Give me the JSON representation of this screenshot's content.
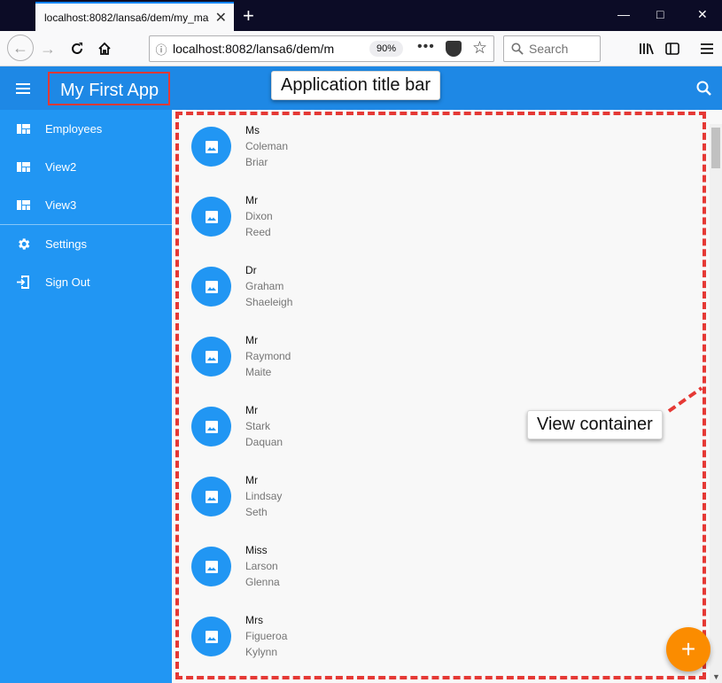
{
  "browser": {
    "tab_title": "localhost:8082/lansa6/dem/my_ma",
    "tab_close": "✕",
    "new_tab": "+",
    "url": "localhost:8082/lansa6/dem/m",
    "zoom": "90%",
    "search_placeholder": "Search",
    "more_icon": "•••",
    "star_icon": "☆"
  },
  "app": {
    "title": "My First App",
    "title_callout": "Application title bar",
    "view_callout": "View container",
    "fab_label": "+"
  },
  "sidebar": {
    "items": [
      {
        "label": "Employees",
        "icon": "view-quilt-icon"
      },
      {
        "label": "View2",
        "icon": "view-quilt-icon"
      },
      {
        "label": "View3",
        "icon": "view-quilt-icon"
      },
      {
        "label": "Settings",
        "icon": "gear-icon"
      },
      {
        "label": "Sign Out",
        "icon": "exit-icon"
      }
    ]
  },
  "employees": [
    {
      "title": "Ms",
      "surname": "Coleman",
      "given": "Briar"
    },
    {
      "title": "Mr",
      "surname": "Dixon",
      "given": "Reed"
    },
    {
      "title": "Dr",
      "surname": "Graham",
      "given": "Shaeleigh"
    },
    {
      "title": "Mr",
      "surname": "Raymond",
      "given": "Maite"
    },
    {
      "title": "Mr",
      "surname": "Stark",
      "given": "Daquan"
    },
    {
      "title": "Mr",
      "surname": "Lindsay",
      "given": "Seth"
    },
    {
      "title": "Miss",
      "surname": "Larson",
      "given": "Glenna"
    },
    {
      "title": "Mrs",
      "surname": "Figueroa",
      "given": "Kylynn"
    }
  ],
  "colors": {
    "appbar": "#1e88e5",
    "sidebar": "#2196f3",
    "accent": "#fb8c00",
    "annotation": "#e53935"
  }
}
